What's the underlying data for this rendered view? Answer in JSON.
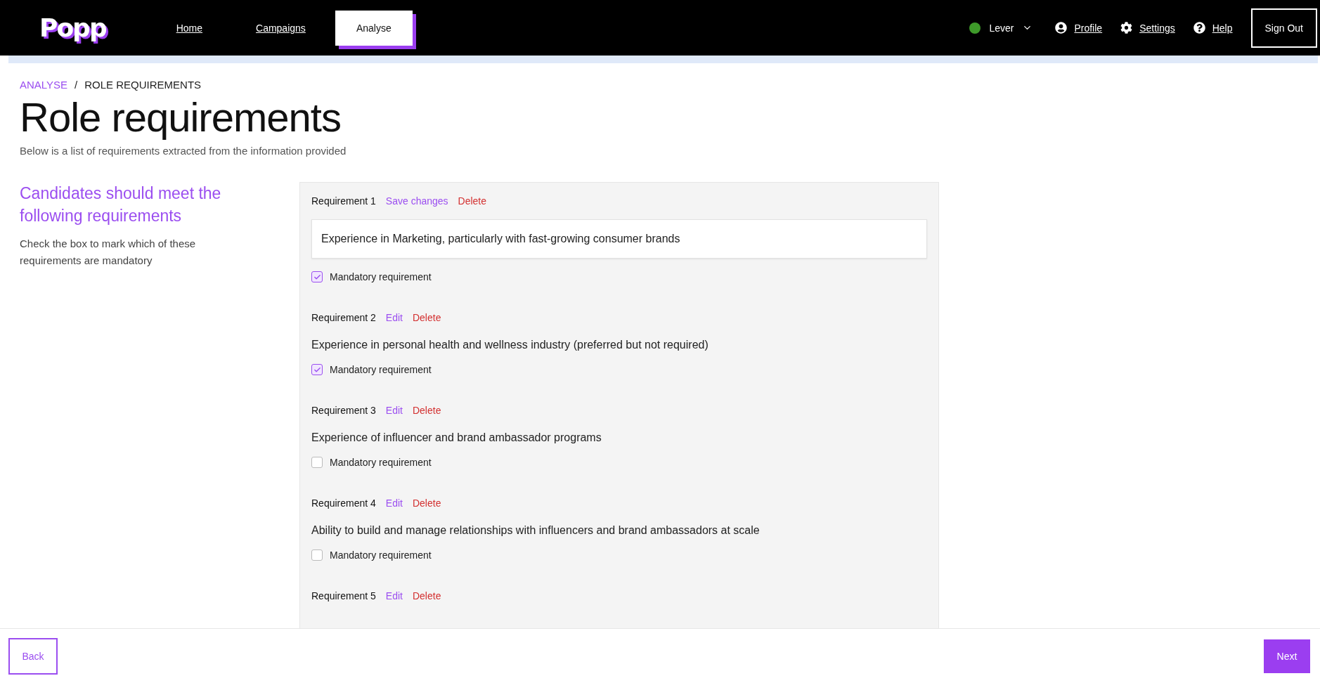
{
  "header": {
    "logo": "Popp",
    "nav": [
      {
        "label": "Home",
        "selected": false
      },
      {
        "label": "Campaigns",
        "selected": false
      },
      {
        "label": "Analyse",
        "selected": true
      }
    ],
    "integration": {
      "name": "Lever"
    },
    "links": [
      {
        "kind": "profile",
        "label": "Profile"
      },
      {
        "kind": "settings",
        "label": "Settings"
      },
      {
        "kind": "help",
        "label": "Help"
      }
    ],
    "sign_out": "Sign Out"
  },
  "breadcrumb": [
    {
      "label": "ANALYSE",
      "kind": "link"
    },
    {
      "label": "/",
      "kind": "separator"
    },
    {
      "label": "ROLE REQUIREMENTS",
      "kind": "current"
    }
  ],
  "title": "Role requirements",
  "subtitle": "Below is a list of requirements extracted from the information provided",
  "sidebar": {
    "heading": "Candidates should meet the following requirements",
    "hint": "Check the box to mark which of these requirements are mandatory"
  },
  "requirements": [
    {
      "title": "Requirement 1",
      "actions": [
        {
          "kind": "save",
          "label": "Save changes"
        },
        {
          "kind": "delete",
          "label": "Delete"
        }
      ],
      "editing": true,
      "text": "Experience in Marketing, particularly with fast-growing consumer brands",
      "mandatory_label": "Mandatory requirement",
      "mandatory": true
    },
    {
      "title": "Requirement 2",
      "actions": [
        {
          "kind": "edit",
          "label": "Edit"
        },
        {
          "kind": "delete",
          "label": "Delete"
        }
      ],
      "editing": false,
      "text": "Experience in personal health and wellness industry (preferred but not required)",
      "mandatory_label": "Mandatory requirement",
      "mandatory": true
    },
    {
      "title": "Requirement 3",
      "actions": [
        {
          "kind": "edit",
          "label": "Edit"
        },
        {
          "kind": "delete",
          "label": "Delete"
        }
      ],
      "editing": false,
      "text": "Experience of influencer and brand ambassador programs",
      "mandatory_label": "Mandatory requirement",
      "mandatory": false
    },
    {
      "title": "Requirement 4",
      "actions": [
        {
          "kind": "edit",
          "label": "Edit"
        },
        {
          "kind": "delete",
          "label": "Delete"
        }
      ],
      "editing": false,
      "text": "Ability to build and manage relationships with influencers and brand ambassadors at scale",
      "mandatory_label": "Mandatory requirement",
      "mandatory": false
    },
    {
      "title": "Requirement 5",
      "actions": [
        {
          "kind": "edit",
          "label": "Edit"
        },
        {
          "kind": "delete",
          "label": "Delete"
        }
      ]
    }
  ],
  "footer": {
    "back": "Back",
    "next": "Next"
  }
}
